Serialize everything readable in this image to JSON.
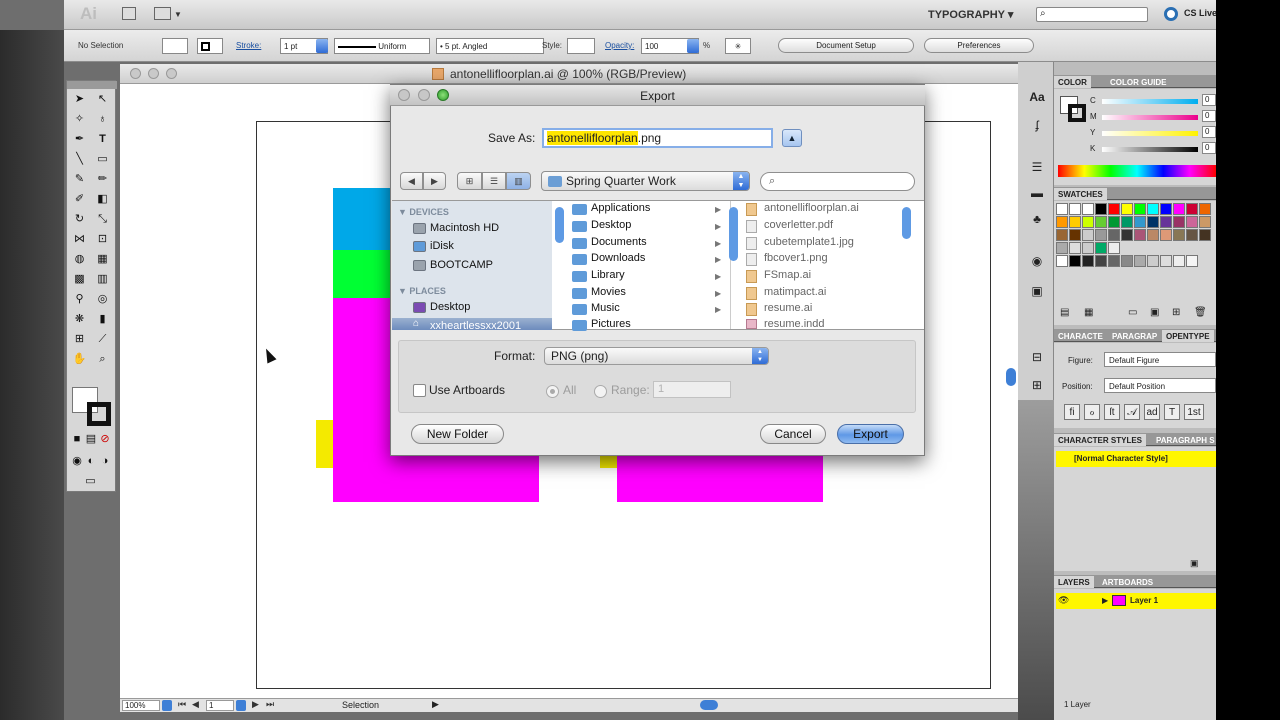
{
  "app": {
    "logo": "Ai",
    "workspace": "TYPOGRAPHY",
    "cs_live": "CS Live"
  },
  "control_bar": {
    "selection": "No Selection",
    "stroke_label": "Stroke:",
    "stroke_weight": "1 pt",
    "profile": "Uniform",
    "brush": "5 pt. Angled",
    "style_label": "Style:",
    "opacity_label": "Opacity:",
    "opacity_value": "100",
    "opacity_unit": "%",
    "document_setup": "Document Setup",
    "preferences": "Preferences"
  },
  "document": {
    "title": "antonellifloorplan.ai @ 100% (RGB/Preview)",
    "zoom": "100%",
    "artboard_number": "1",
    "status": "Selection"
  },
  "export_dialog": {
    "title": "Export",
    "save_as_label": "Save As:",
    "filename_base": "antonellifloorplan",
    "filename_ext": ".png",
    "location": "Spring Quarter Work",
    "devices_header": "DEVICES",
    "devices": [
      "Macintosh HD",
      "iDisk",
      "BOOTCAMP"
    ],
    "places_header": "PLACES",
    "places": [
      "Desktop",
      "xxheartlessxx2001"
    ],
    "folders": [
      "Applications",
      "Desktop",
      "Documents",
      "Downloads",
      "Library",
      "Movies",
      "Music",
      "Pictures"
    ],
    "files": [
      "antonellifloorplan.ai",
      "coverletter.pdf",
      "cubetemplate1.jpg",
      "fbcover1.png",
      "FSmap.ai",
      "matimpact.ai",
      "resume.ai",
      "resume.indd"
    ],
    "format_label": "Format:",
    "format_value": "PNG (png)",
    "use_artboards": "Use Artboards",
    "all_label": "All",
    "range_label": "Range:",
    "range_value": "1",
    "new_folder": "New Folder",
    "cancel": "Cancel",
    "export": "Export"
  },
  "panels": {
    "color_tabs": [
      "COLOR",
      "COLOR GUIDE"
    ],
    "cmyk": [
      {
        "label": "C",
        "value": "0"
      },
      {
        "label": "M",
        "value": "0"
      },
      {
        "label": "Y",
        "value": "0"
      },
      {
        "label": "K",
        "value": "0"
      }
    ],
    "swatches_tab": "SWATCHES",
    "type_tabs": [
      "CHARACTE",
      "PARAGRAP",
      "OPENTYPE"
    ],
    "figure_label": "Figure:",
    "figure_value": "Default Figure",
    "position_label": "Position:",
    "position_value": "Default Position",
    "style_tabs": [
      "CHARACTER STYLES",
      "PARAGRAPH S"
    ],
    "normal_style": "[Normal Character Style]",
    "layer_tabs": [
      "LAYERS",
      "ARTBOARDS"
    ],
    "layer_name": "Layer 1",
    "layer_count": "1 Layer"
  },
  "colors": {
    "cyan": "#00a8e8",
    "green": "#00ff33",
    "magenta": "#ff00ff",
    "yellow": "#f4ea00",
    "accent": "#3e7fd6"
  }
}
